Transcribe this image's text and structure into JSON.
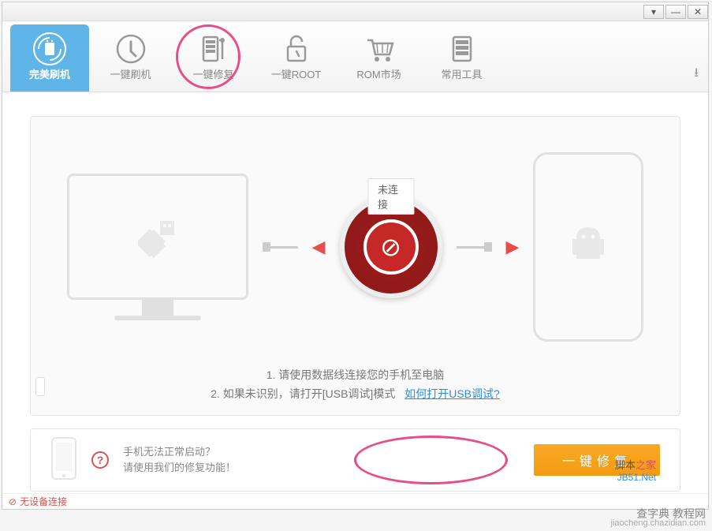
{
  "window": {
    "dropdown_glyph": "▾",
    "min_glyph": "—",
    "close_glyph": "✕"
  },
  "toolbar": {
    "tabs": [
      {
        "label": "完美刷机"
      },
      {
        "label": "一键刷机"
      },
      {
        "label": "一键修复"
      },
      {
        "label": "一键ROOT"
      },
      {
        "label": "ROM市场"
      },
      {
        "label": "常用工具"
      }
    ],
    "download_glyph": "⭳"
  },
  "connection": {
    "status": "未连接",
    "no_sign": "⊘",
    "arrow_left": "◀",
    "arrow_right": "▶"
  },
  "instructions": {
    "line1": "1. 请使用数据线连接您的手机至电脑",
    "line2_prefix": "2. 如果未识别，请打开[USB调试]模式",
    "link": "如何打开USB调试?"
  },
  "footer": {
    "qmark": "?",
    "line1": "手机无法正常启动？",
    "line2": "请使用我们的修复功能！",
    "button": "一键修复",
    "brand1a": "脚本",
    "brand1b": "之家",
    "brand2": "JB51.Net"
  },
  "statusbar": {
    "icon": "⊘",
    "text": "无设备连接"
  },
  "watermark": {
    "line1": "查字典 教程网",
    "line2": "jiaocheng.chazidian.com"
  }
}
